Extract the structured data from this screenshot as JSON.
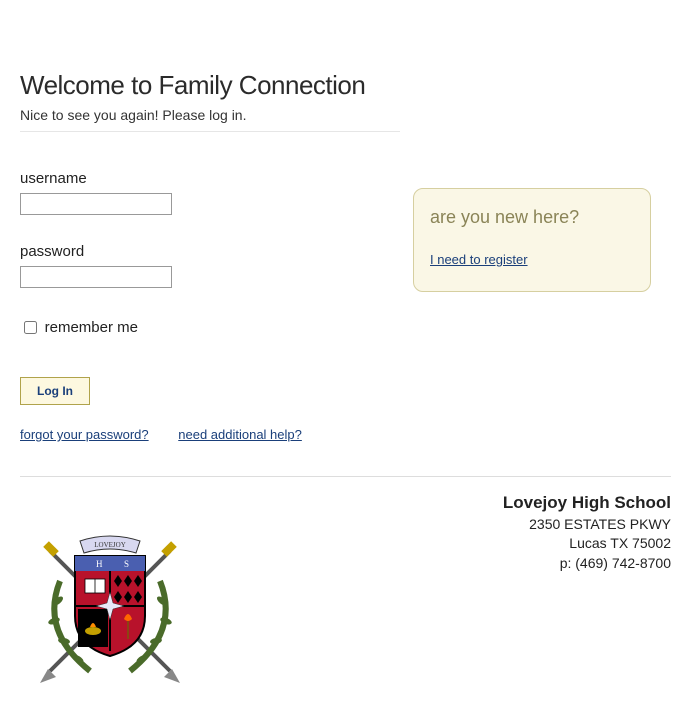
{
  "header": {
    "title": "Welcome to Family Connection",
    "subtitle": "Nice to see you again! Please log in."
  },
  "form": {
    "username_label": "username",
    "username_value": "",
    "password_label": "password",
    "password_value": "",
    "remember_label": "remember me",
    "remember_checked": false,
    "login_button": "Log In"
  },
  "links": {
    "forgot": "forgot your password?",
    "help": "need additional help?"
  },
  "newbox": {
    "title": "are you new here?",
    "register_link": "I need to register"
  },
  "school": {
    "name": "Lovejoy High School",
    "address1": "2350 ESTATES PKWY",
    "address2": "Lucas TX 75002",
    "phone": "p: (469) 742-8700"
  }
}
